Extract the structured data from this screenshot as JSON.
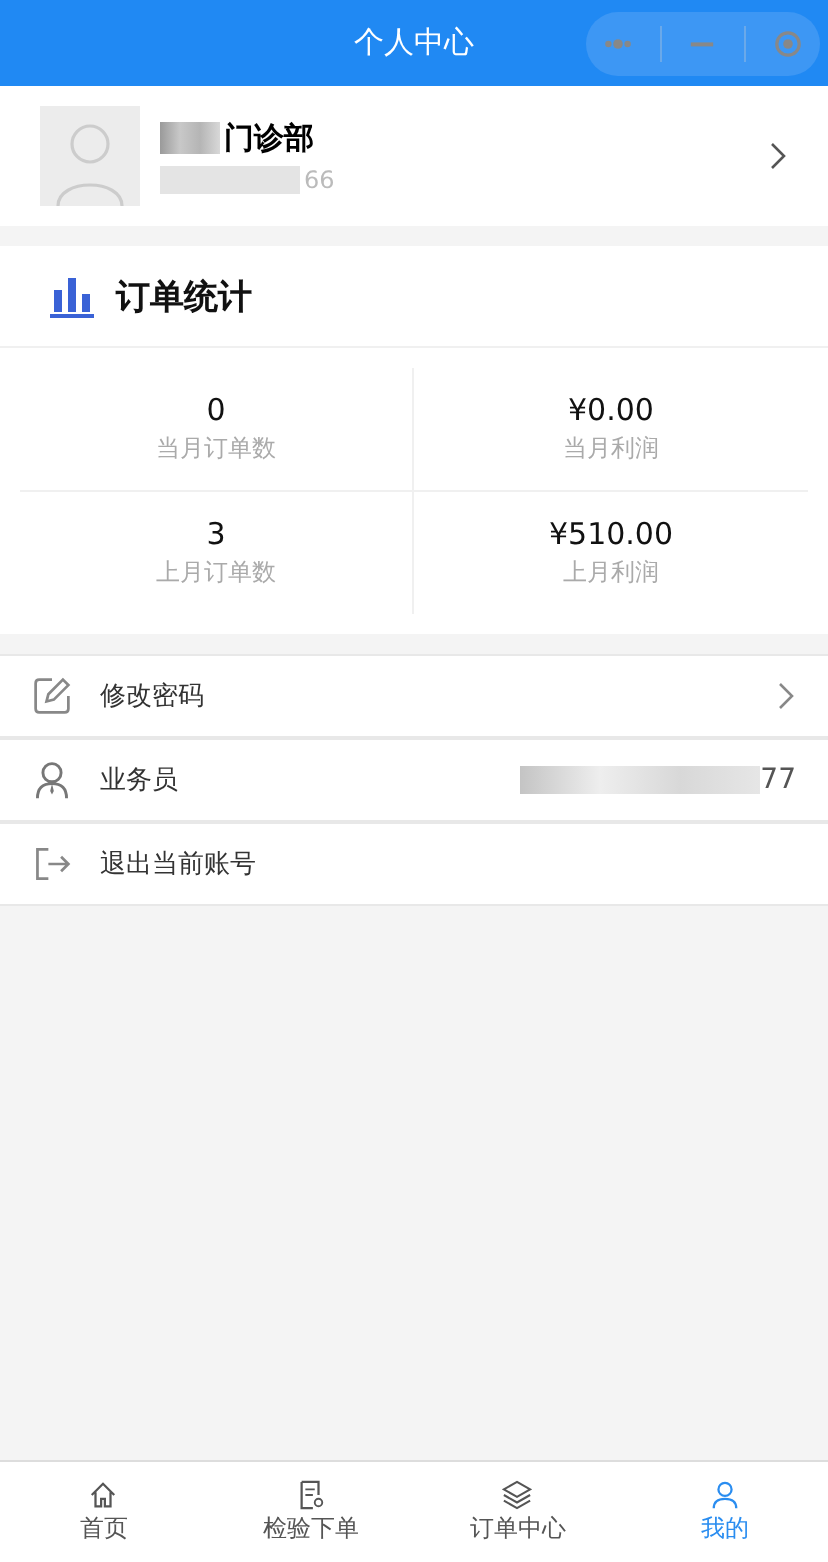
{
  "header": {
    "title": "个人中心"
  },
  "profile": {
    "name": "门诊部",
    "phone_tail": "66"
  },
  "stats": {
    "title": "订单统计",
    "cells": [
      {
        "value": "0",
        "label": "当月订单数"
      },
      {
        "value": "¥0.00",
        "label": "当月利润"
      },
      {
        "value": "3",
        "label": "上月订单数"
      },
      {
        "value": "¥510.00",
        "label": "上月利润"
      }
    ]
  },
  "menu": [
    {
      "kind": "edit",
      "label": "修改密码",
      "arrow": true
    },
    {
      "kind": "person",
      "label": "业务员",
      "value": "77",
      "arrow": false
    },
    {
      "kind": "logout",
      "label": "退出当前账号",
      "arrow": false
    }
  ],
  "tabs": [
    {
      "kind": "home",
      "label": "首页",
      "selected": false
    },
    {
      "kind": "doc",
      "label": "检验下单",
      "selected": false
    },
    {
      "kind": "layers",
      "label": "订单中心",
      "selected": false
    },
    {
      "kind": "user",
      "label": "我的",
      "selected": true
    }
  ]
}
